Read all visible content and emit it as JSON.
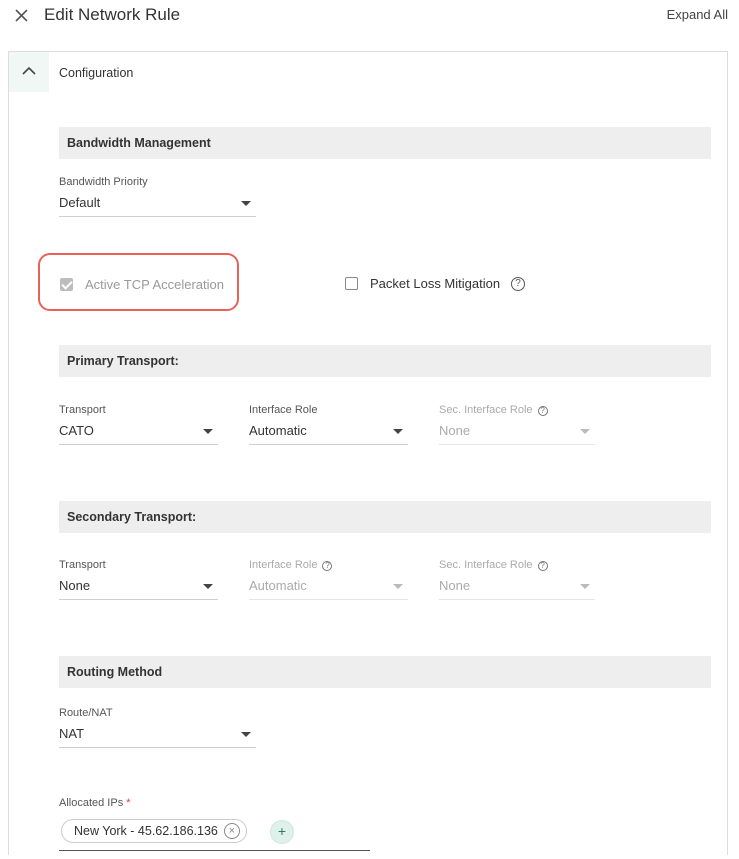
{
  "header": {
    "title": "Edit Network Rule",
    "expand_all": "Expand All"
  },
  "panel": {
    "title": "Configuration"
  },
  "bandwidth": {
    "section_title": "Bandwidth Management",
    "priority_label": "Bandwidth Priority",
    "priority_value": "Default"
  },
  "options": {
    "tcp_label": "Active TCP Acceleration",
    "tcp_checked": true,
    "plm_label": "Packet Loss Mitigation",
    "plm_checked": false,
    "help_glyph": "?"
  },
  "primary": {
    "section_title": "Primary Transport:",
    "transport_label": "Transport",
    "transport_value": "CATO",
    "role_label": "Interface Role",
    "role_value": "Automatic",
    "sec_role_label": "Sec. Interface Role",
    "sec_role_value": "None"
  },
  "secondary": {
    "section_title": "Secondary Transport:",
    "transport_label": "Transport",
    "transport_value": "None",
    "role_label": "Interface Role",
    "role_value": "Automatic",
    "sec_role_label": "Sec. Interface Role",
    "sec_role_value": "None"
  },
  "routing": {
    "section_title": "Routing Method",
    "route_label": "Route/NAT",
    "route_value": "NAT",
    "ips_label": "Allocated IPs",
    "required_mark": "*",
    "ips": [
      "New York - 45.62.186.136"
    ],
    "remove_glyph": "×",
    "add_glyph": "+"
  },
  "colors": {
    "highlight": "#e8625a",
    "section_bg": "#eeeeee",
    "toggle_bg": "#f1f7f5",
    "add_bg": "#dff1ea"
  },
  "icons": {
    "close": "close-icon",
    "collapse": "chevron-up-icon",
    "dropdown": "caret-down-icon",
    "help": "help-circle-icon",
    "remove": "chip-remove-icon",
    "add": "plus-icon"
  }
}
